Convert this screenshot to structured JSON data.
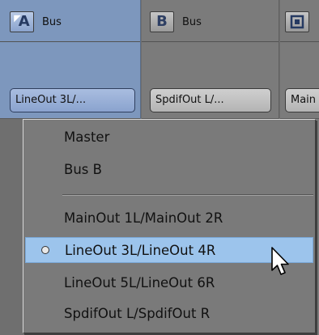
{
  "strips": [
    {
      "letter": "A",
      "label": "Bus",
      "output": "LineOut 3L/..."
    },
    {
      "letter": "B",
      "label": "Bus",
      "output": "SpdifOut L/..."
    },
    {
      "letter": "",
      "label": "",
      "output": "Main"
    }
  ],
  "menu": {
    "items": [
      {
        "label": "Master"
      },
      {
        "label": "Bus B"
      },
      {
        "label": "MainOut 1L/MainOut 2R"
      },
      {
        "label": "LineOut 3L/LineOut 4R",
        "selected": true
      },
      {
        "label": "LineOut 5L/LineOut 6R"
      },
      {
        "label": "SpdifOut L/SpdifOut R"
      }
    ]
  },
  "colors": {
    "strip_active": "#7d97bd",
    "selected_item": "#9cc4ec"
  }
}
